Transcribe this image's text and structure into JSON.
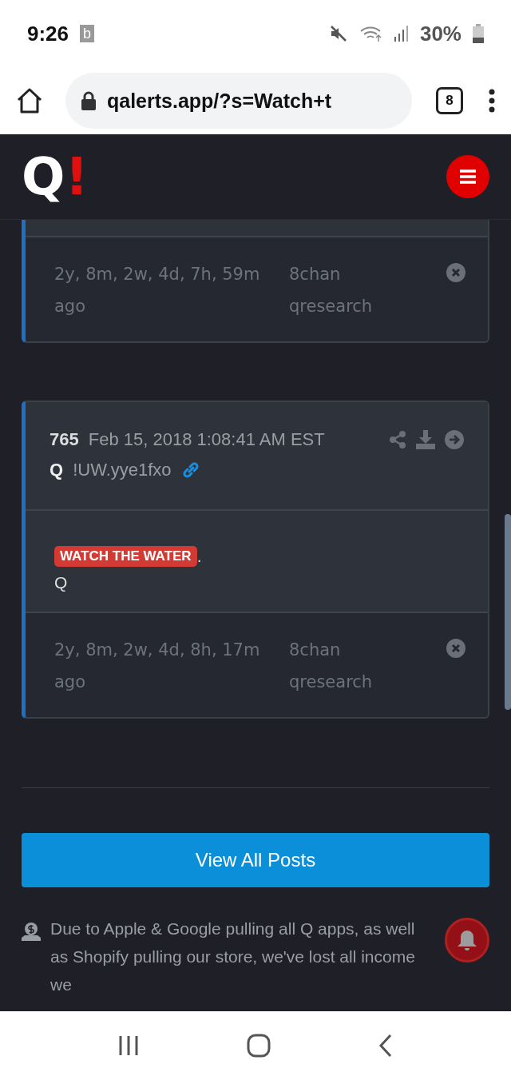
{
  "status_bar": {
    "time": "9:26",
    "notification": "b",
    "battery": "30%"
  },
  "browser": {
    "url": "qalerts.app/?s=Watch+t",
    "tab_count": "8"
  },
  "site_header": {
    "logo_letter": "Q",
    "logo_mark": "!"
  },
  "posts": [
    {
      "ago": "2y, 8m, 2w, 4d, 7h, 59m ago",
      "source": "8chan qresearch"
    },
    {
      "number": "765",
      "date": "Feb 15, 2018 1:08:41 AM EST",
      "author": "Q",
      "tripcode": "!UW.yye1fxo",
      "body": [
        [
          {
            "kind": "highlight",
            "text": "WATCH THE WATER"
          },
          {
            "kind": "plain",
            "text": "."
          }
        ],
        [
          {
            "kind": "plain",
            "text": "Q"
          }
        ]
      ],
      "ago": "2y, 8m, 2w, 4d, 8h, 17m ago",
      "source": "8chan qresearch"
    }
  ],
  "view_all_button": "View All Posts",
  "notice": "Due to Apple & Google pulling all Q apps, as well as Shopify pulling our store, we've lost all income we"
}
